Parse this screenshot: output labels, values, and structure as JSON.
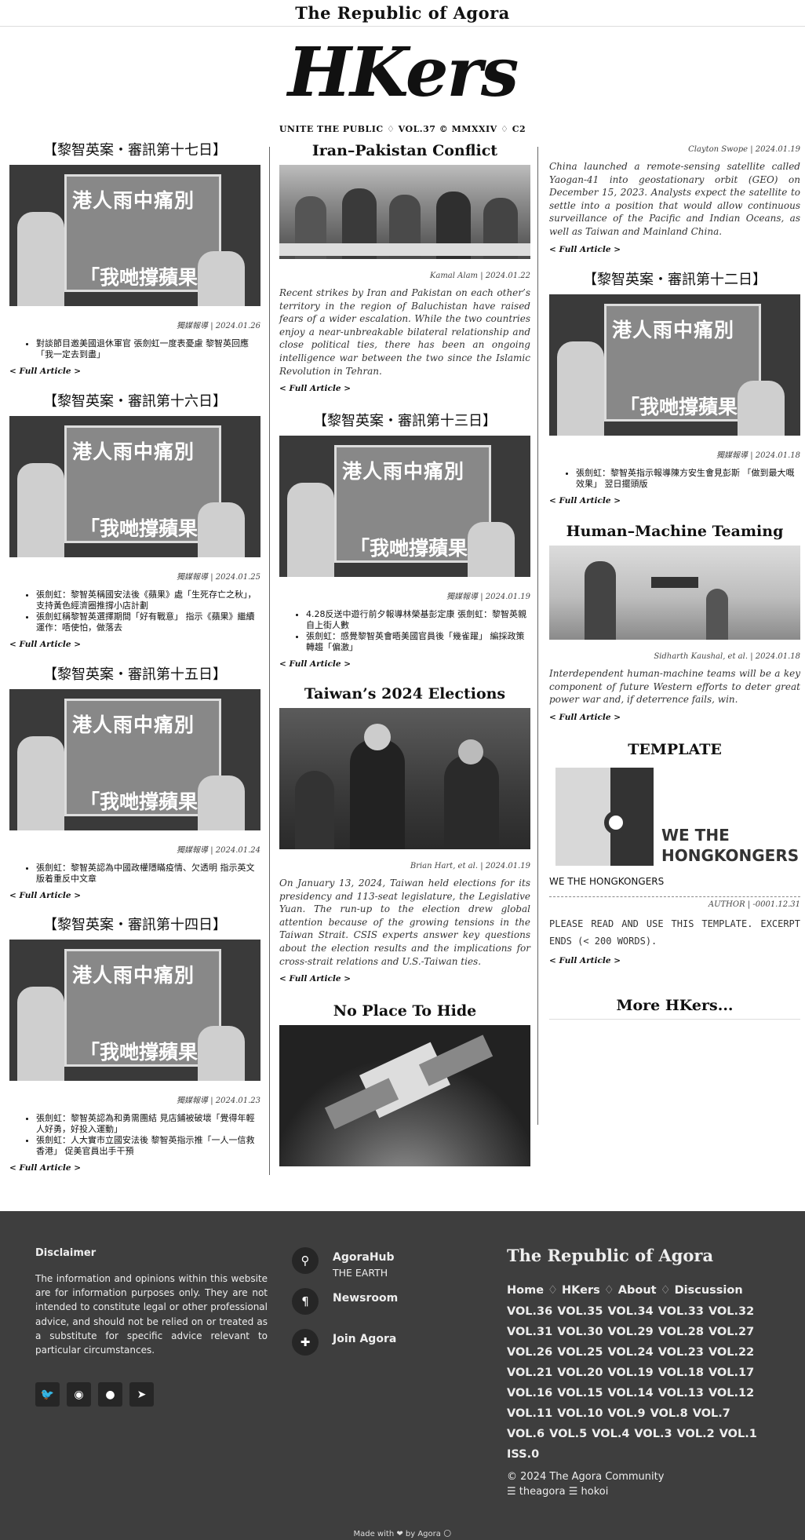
{
  "topbar": {
    "brand": "The Republic of Agora"
  },
  "masthead": {
    "logo": "HKers",
    "subtitle": "UNITE THE PUBLIC ♢ VOL.37 © MMXXIV ♢ C2"
  },
  "read_more": "< Full Article >",
  "col1": [
    {
      "title": "【黎智英案・審訊第十七日】",
      "byline": "獨媒報導 | 2024.01.26",
      "bullets": [
        "對談節目邀美國退休軍官 張劍虹一度表憂慮 黎智英回應「我一定去到盡」"
      ],
      "photo_text": [
        "港人雨中痛別",
        "「我哋撐蘋果"
      ]
    },
    {
      "title": "【黎智英案・審訊第十六日】",
      "byline": "獨媒報導 | 2024.01.25",
      "bullets": [
        "張劍虹：黎智英稱國安法後《蘋果》處「生死存亡之秋」，支持黃色經濟圈推撐小店計劃",
        "張劍虹稱黎智英選擇期間「好有戰意」 指示《蘋果》繼續運作：唔使怕，做落去"
      ],
      "photo_text": [
        "港人雨中痛別",
        "「我哋撐蘋果"
      ]
    },
    {
      "title": "【黎智英案・審訊第十五日】",
      "byline": "獨媒報導 | 2024.01.24",
      "bullets": [
        "張劍虹：黎智英認為中國政權隱瞞疫情、欠透明 指示英文版着重反中文章"
      ],
      "photo_text": [
        "港人雨中痛別",
        "「我哋撐蘋果"
      ]
    },
    {
      "title": "【黎智英案・審訊第十四日】",
      "byline": "獨媒報導 | 2024.01.23",
      "bullets": [
        "張劍虹：黎智英認為和勇需團結 見店鋪被破壞「覺得年輕人好勇，好投入運動」",
        "張劍虹：人大實市立國安法後 黎智英指示推「一人一信救香港」 促美官員出手干預"
      ],
      "photo_text": [
        "港人雨中痛別",
        "「我哋撐蘋果"
      ]
    }
  ],
  "col2": [
    {
      "title": "Iran–Pakistan Conflict",
      "byline": "Kamal Alam | 2024.01.22",
      "summary": "Recent strikes by Iran and Pakistan on each other’s territory in the region of Baluchistan have raised fears of a wider escalation. While the two countries enjoy a near-unbreakable bilateral relationship and close political ties, there has been an ongoing intelligence war between the two since the Islamic Revolution in Tehran."
    },
    {
      "title": "【黎智英案・審訊第十三日】",
      "byline": "獨媒報導 | 2024.01.19",
      "bullets": [
        "4.28反送中遊行前夕報導林榮基彭定康 張劍虹：黎智英親自上街人數",
        "張劍虹：感覺黎智英會晤美國官員後「幾雀躍」 編採政策轉趨「偏激」"
      ],
      "photo_text": [
        "港人雨中痛別",
        "「我哋撐蘋果"
      ]
    },
    {
      "title": "Taiwan’s 2024 Elections",
      "byline": "Brian Hart, et al. | 2024.01.19",
      "summary": "On January 13, 2024, Taiwan held elections for its presidency and 113-seat legislature, the Legislative Yuan. The run-up to the election drew global attention because of the growing tensions in the Taiwan Strait. CSIS experts answer key questions about the election results and the implications for cross-strait relations and U.S.-Taiwan ties."
    },
    {
      "title": "No Place To Hide"
    }
  ],
  "col3": [
    {
      "byline": "Clayton Swope | 2024.01.19",
      "summary": "China launched a remote-sensing satellite called Yaogan-41 into geostationary orbit (GEO) on December 15, 2023. Analysts expect the satellite to settle into a position that would allow continuous surveillance of the Pacific and Indian Oceans, as well as Taiwan and Mainland China."
    },
    {
      "title": "【黎智英案・審訊第十二日】",
      "byline": "獨媒報導 | 2024.01.18",
      "bullets": [
        "張劍虹：黎智英指示報導陳方安生會見彭斯 「做到最大嘅效果」 翌日擺頭版"
      ],
      "photo_text": [
        "港人雨中痛別",
        "「我哋撐蘋果"
      ]
    },
    {
      "title": "Human–Machine Teaming",
      "byline": "Sidharth Kaushal, et al. | 2024.01.18",
      "summary": "Interdependent human-machine teams will be a key component of future Western efforts to deter great power war and, if deterrence fails, win."
    },
    {
      "title": "TEMPLATE",
      "logo_text": [
        "WE THE",
        "HONGKONGERS"
      ],
      "caption": "WE THE HONGKONGERS",
      "byline": "AUTHOR | -0001.12.31",
      "summary": "PLEASE READ AND USE THIS TEMPLATE. EXCERPT ENDS (< 200 WORDS)."
    },
    {
      "more": "More HKers..."
    }
  ],
  "footer": {
    "disclaimer_title": "Disclaimer",
    "disclaimer_text": "The information and opinions within this website are for information purposes only. They are not intended to constitute legal or other professional advice, and should not be relied on or treated as a substitute for specific advice relevant to particular circumstances.",
    "socials": [
      "twitter-icon",
      "github-icon",
      "reddit-icon",
      "telegram-icon"
    ],
    "links": [
      {
        "icon": "map-pin-icon",
        "title": "AgoraHub",
        "sub": "THE EARTH"
      },
      {
        "icon": "pilcrow-icon",
        "title": "Newsroom",
        "sub": ""
      },
      {
        "icon": "puzzle-icon",
        "title": "Join Agora",
        "sub": ""
      }
    ],
    "brand": "The Republic of Agora",
    "nav": [
      "Home",
      "HKers",
      "About",
      "Discussion"
    ],
    "nav_sep": "♢",
    "volumes": [
      "VOL.36",
      "VOL.35",
      "VOL.34",
      "VOL.33",
      "VOL.32",
      "VOL.31",
      "VOL.30",
      "VOL.29",
      "VOL.28",
      "VOL.27",
      "VOL.26",
      "VOL.25",
      "VOL.24",
      "VOL.23",
      "VOL.22",
      "VOL.21",
      "VOL.20",
      "VOL.19",
      "VOL.18",
      "VOL.17",
      "VOL.16",
      "VOL.15",
      "VOL.14",
      "VOL.13",
      "VOL.12",
      "VOL.11",
      "VOL.10",
      "VOL.9",
      "VOL.8",
      "VOL.7",
      "VOL.6",
      "VOL.5",
      "VOL.4",
      "VOL.3",
      "VOL.2",
      "VOL.1",
      "ISS.0"
    ],
    "copyright": "© 2024 The Agora Community",
    "credits": "☰ theagora ☰ hokoi",
    "made_with": "Made with ❤ by Agora 🌕"
  }
}
